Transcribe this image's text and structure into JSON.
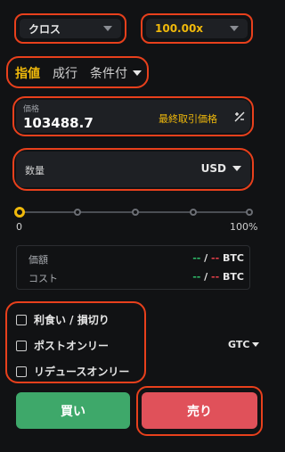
{
  "margin_mode": {
    "value": "クロス"
  },
  "leverage": {
    "value": "100.00x"
  },
  "order_tabs": [
    {
      "label": "指値",
      "active": true
    },
    {
      "label": "成行",
      "active": false
    },
    {
      "label": "条件付",
      "active": false
    }
  ],
  "price": {
    "label": "価格",
    "value": "103488.7",
    "last_price_label": "最終取引価格"
  },
  "quantity": {
    "label": "数量",
    "unit": "USD"
  },
  "slider": {
    "min_label": "0",
    "max_label": "100%",
    "level": 0
  },
  "info": {
    "amount_label": "価額",
    "amount_buy": "--",
    "amount_sell": "--",
    "amount_unit": "BTC",
    "cost_label": "コスト",
    "cost_buy": "--",
    "cost_sell": "--",
    "cost_unit": "BTC",
    "separator": "/"
  },
  "options": [
    {
      "label": "利食い / 損切り"
    },
    {
      "label": "ポストオンリー"
    },
    {
      "label": "リデュースオンリー"
    }
  ],
  "time_in_force": {
    "value": "GTC"
  },
  "buttons": {
    "buy": "買い",
    "sell": "売り"
  },
  "colors": {
    "accent": "#f0b90b",
    "buy": "#3ea86a",
    "sell": "#e0515a",
    "highlight": "#e8401c"
  }
}
